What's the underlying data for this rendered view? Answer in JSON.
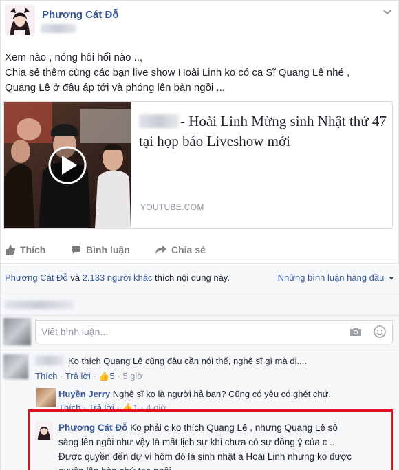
{
  "post": {
    "author": "Phương Cát Đỗ",
    "lines": [
      "Xem nào , nóng hôi hổi nào ..,",
      "Chia sẻ thêm cùng các bạn live show Hoài Linh ko có ca Sĩ Quang Lê nhé ,",
      "Quang Lê ở đâu áp tới và phóng lên bàn ngồi ..."
    ]
  },
  "link": {
    "title": "- Hoài Linh Mừng sinh Nhật thứ 47 tại họp báo Liveshow mới",
    "domain": "YOUTUBE.COM"
  },
  "actions": {
    "like": "Thích",
    "comment": "Bình luận",
    "share": "Chia sẻ"
  },
  "likes": {
    "first": "Phương Cát Đỗ",
    "and": " và ",
    "others": "2.133 người khác",
    "suffix": " thích nội dung này."
  },
  "sort_label": "Những bình luận hàng đầu",
  "composer": {
    "placeholder": "Viết bình luận..."
  },
  "comments": [
    {
      "text": "Ko thích Quang Lê cũng đâu cần nói thế, nghệ sĩ gì mà dị....",
      "like": "Thích",
      "reply": "Trả lời",
      "likes": "5",
      "time": "5 giờ"
    }
  ],
  "reply": {
    "name": "Huyền Jerry",
    "text": "Nghệ sĩ ko là người hả bạn? Cũng có yêu có ghét chứ.",
    "like": "Thích",
    "reply": "Trả lời",
    "likes": "1",
    "time": "4 giờ"
  },
  "highlight": {
    "name": "Phương Cát Đỗ",
    "line1": "Ko phải c ko thích Quang Lê , nhưng Quang Lê sỗ",
    "line2": "sàng lên ngồi như vậy là mất lịch sự khi chưa có sự đồng ý của c ..",
    "line3": "Được quyền đến dự vì hôm đó là sinh nhật a Hoài Linh nhưng ko được",
    "line4": "quyền lên bàn chứ toạ ngồi"
  },
  "colors": {
    "link": "#365899",
    "highlight_border": "#e1101a"
  }
}
